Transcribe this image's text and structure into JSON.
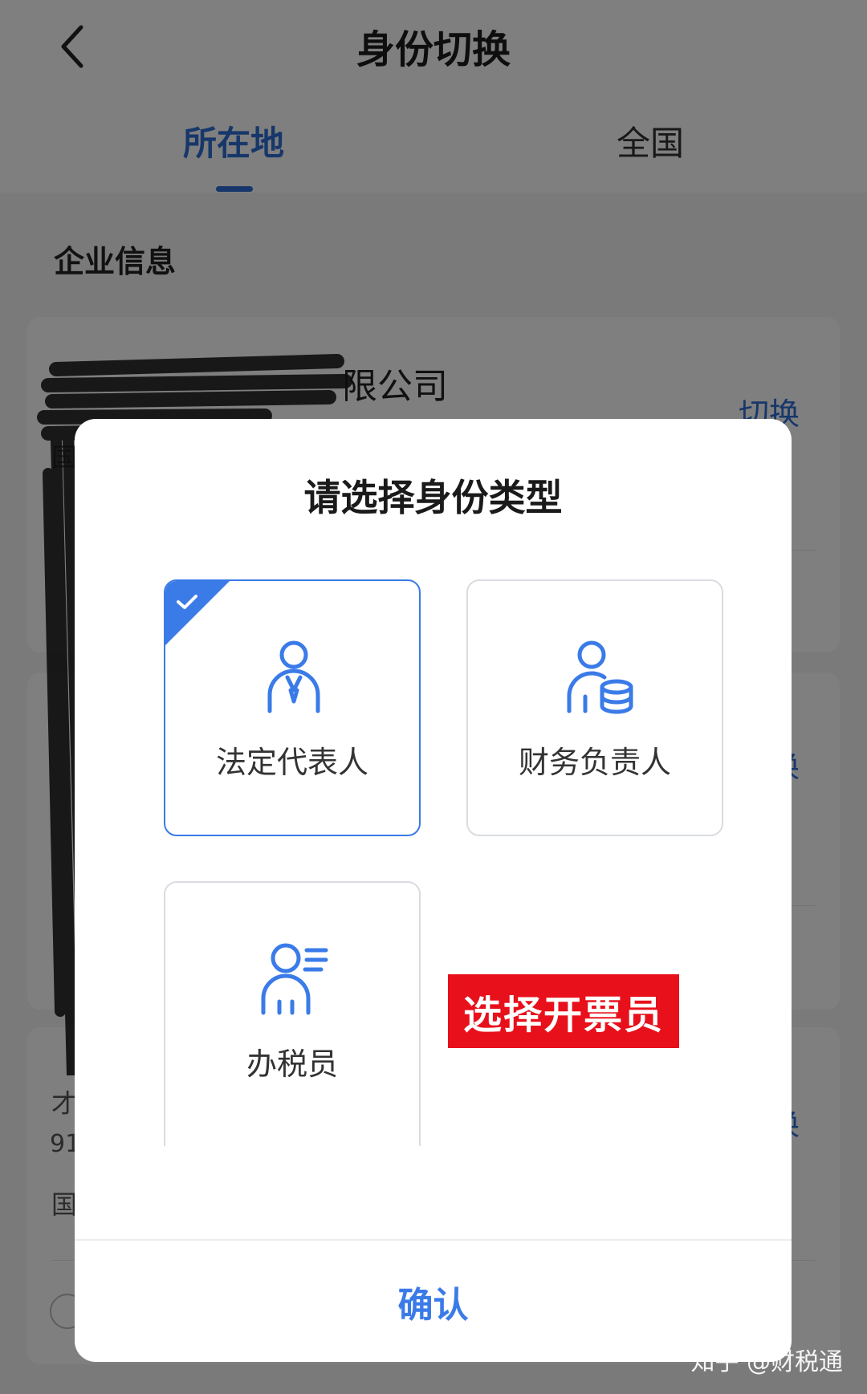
{
  "header": {
    "back_icon": "chevron-left-icon",
    "title": "身份切换",
    "tabs": [
      {
        "label": "所在地",
        "active": true
      },
      {
        "label": "全国",
        "active": false
      }
    ]
  },
  "section": {
    "title": "企业信息"
  },
  "companies": [
    {
      "name_visible": "限公司",
      "switch_label": "切换",
      "side_char": "国"
    },
    {
      "switch_label": "换"
    },
    {
      "credit_code_prefix": "91",
      "switch_label": "换",
      "side_chars": [
        "才",
        "国"
      ]
    }
  ],
  "modal": {
    "title": "请选择身份类型",
    "roles": [
      {
        "label": "法定代表人",
        "icon": "legal-person-icon",
        "selected": true
      },
      {
        "label": "财务负责人",
        "icon": "finance-manager-icon",
        "selected": false
      },
      {
        "label": "办税员",
        "icon": "tax-clerk-icon",
        "selected": false
      }
    ],
    "confirm_label": "确认"
  },
  "annotation": {
    "text": "选择开票员",
    "color": "#e8101b"
  },
  "watermark": "知乎 @财税通",
  "colors": {
    "accent": "#3a7be8",
    "overlay": "rgba(0,0,0,0.5)"
  }
}
